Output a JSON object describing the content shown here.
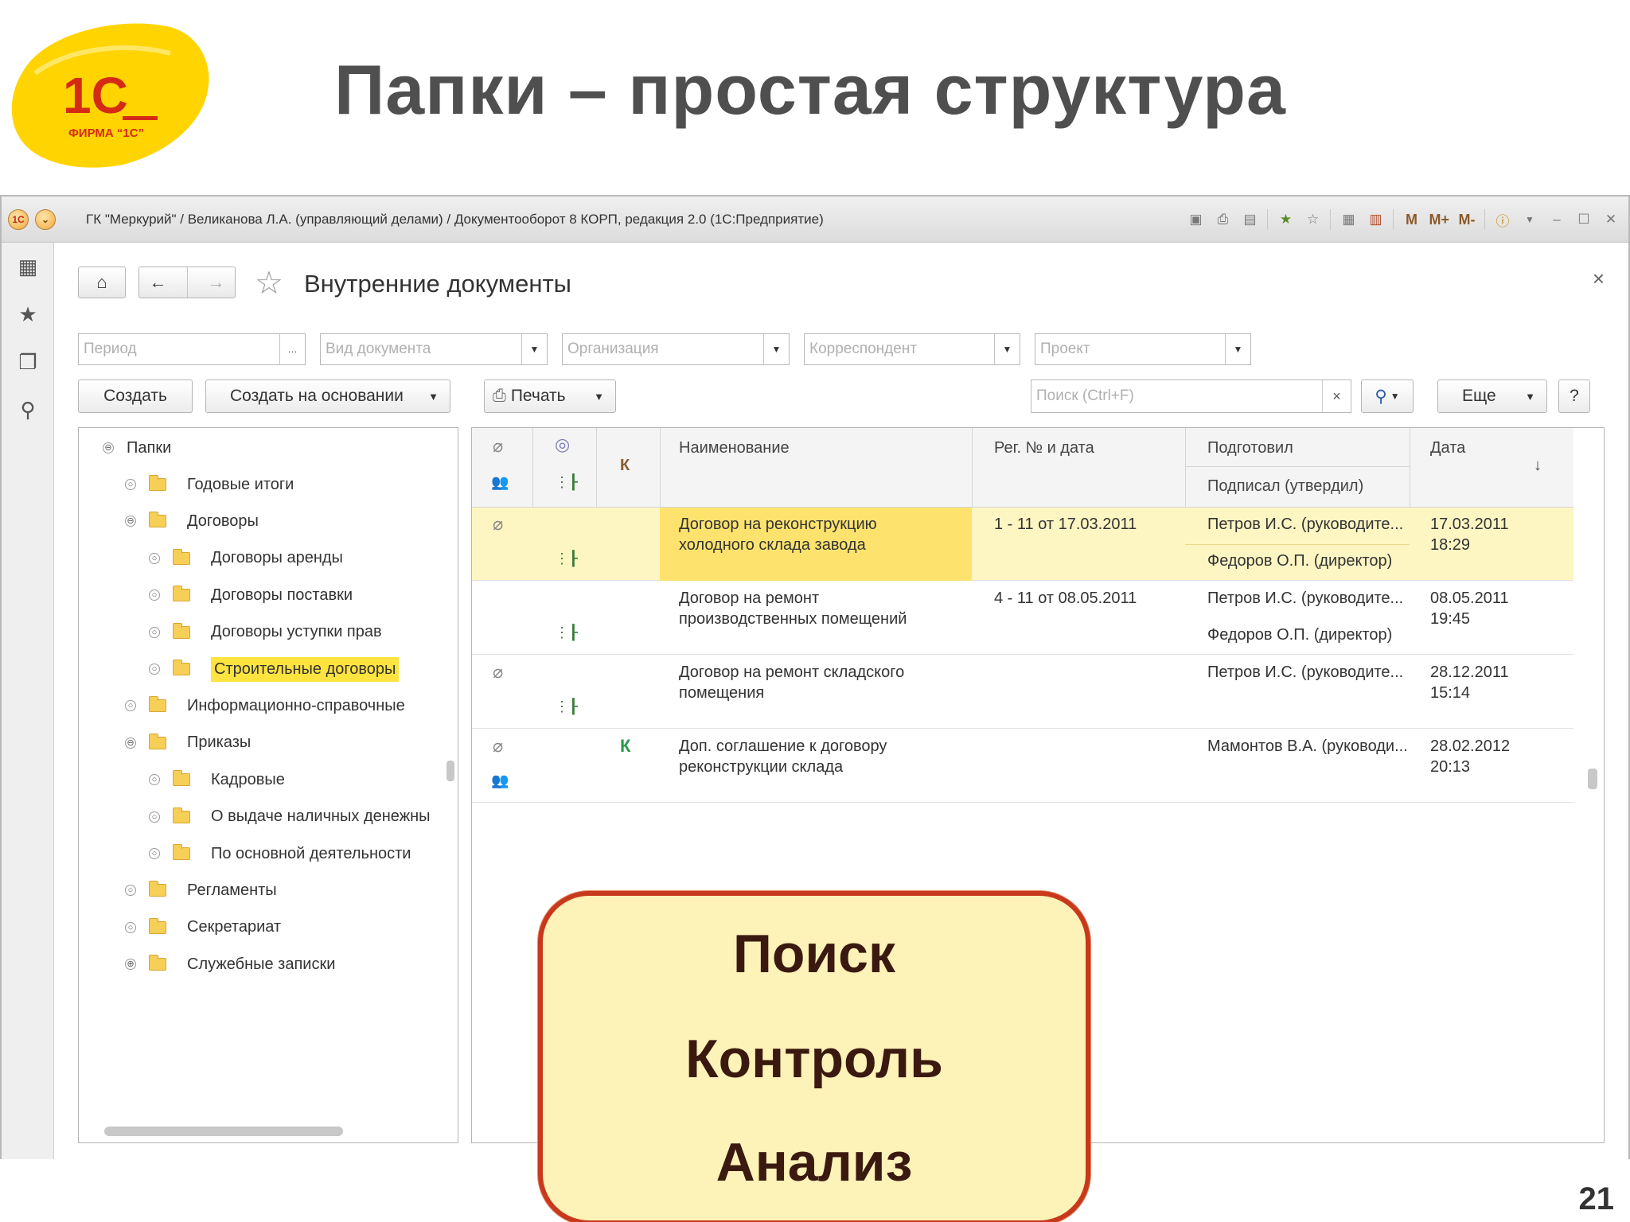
{
  "slide": {
    "title": "Папки – простая структура",
    "number": "21",
    "logo_text": "1С",
    "logo_caption": "ФИРМА “1С”"
  },
  "window": {
    "title": "ГК \"Меркурий\" / Великанова Л.А. (управляющий делами) / Документооборот 8 КОРП, редакция 2.0  (1С:Предприятие)",
    "toolbar_labels": {
      "m": "M",
      "mplus": "M+",
      "mminus": "M-"
    }
  },
  "form": {
    "title": "Внутренние документы",
    "filters": [
      {
        "placeholder": "Период",
        "has_ellipsis": true
      },
      {
        "placeholder": "Вид документа"
      },
      {
        "placeholder": "Организация"
      },
      {
        "placeholder": "Корреспондент"
      },
      {
        "placeholder": "Проект"
      }
    ],
    "buttons": {
      "create": "Создать",
      "create_based": "Создать на основании",
      "print": "Печать",
      "more": "Еще",
      "help": "?"
    },
    "search_placeholder": "Поиск (Ctrl+F)"
  },
  "tree": {
    "root": "Папки",
    "items": [
      {
        "label": "Годовые итоги",
        "level": 1,
        "toggle": "○"
      },
      {
        "label": "Договоры",
        "level": 1,
        "toggle": "⊖"
      },
      {
        "label": "Договоры аренды",
        "level": 2,
        "toggle": "○"
      },
      {
        "label": "Договоры поставки",
        "level": 2,
        "toggle": "○"
      },
      {
        "label": "Договоры уступки прав",
        "level": 2,
        "toggle": "○"
      },
      {
        "label": "Строительные договоры",
        "level": 2,
        "toggle": "○",
        "selected": true
      },
      {
        "label": "Информационно-справочные",
        "level": 1,
        "toggle": "○"
      },
      {
        "label": "Приказы",
        "level": 1,
        "toggle": "⊖"
      },
      {
        "label": "Кадровые",
        "level": 2,
        "toggle": "○"
      },
      {
        "label": "О выдаче наличных денежны",
        "level": 2,
        "toggle": "○"
      },
      {
        "label": "По основной деятельности",
        "level": 2,
        "toggle": "○"
      },
      {
        "label": "Регламенты",
        "level": 1,
        "toggle": "○"
      },
      {
        "label": "Секретариат",
        "level": 1,
        "toggle": "○"
      },
      {
        "label": "Служебные записки",
        "level": 1,
        "toggle": "⊕"
      }
    ]
  },
  "table": {
    "headers": {
      "k": "К",
      "name": "Наименование",
      "reg": "Рег. № и дата",
      "prepared": "Подготовил",
      "signed": "Подписал (утвердил)",
      "date": "Дата",
      "sort": "↓"
    },
    "rows": [
      {
        "attach": true,
        "people": false,
        "k": "",
        "name1": "Договор на реконструкцию",
        "name2": "холодного склада завода",
        "reg": "1 - 11 от 17.03.2011",
        "prepared": "Петров И.С. (руководите...",
        "signed": "Федоров О.П. (директор)",
        "date1": "17.03.2011",
        "date2": "18:29"
      },
      {
        "attach": false,
        "people": false,
        "k": "",
        "name1": "Договор на ремонт",
        "name2": "производственных помещений",
        "reg": "4 - 11 от 08.05.2011",
        "prepared": "Петров И.С. (руководите...",
        "signed": "Федоров О.П. (директор)",
        "date1": "08.05.2011",
        "date2": "19:45"
      },
      {
        "attach": true,
        "people": false,
        "k": "",
        "name1": "Договор на ремонт складского",
        "name2": "помещения",
        "reg": "",
        "prepared": "Петров И.С. (руководите...",
        "signed": "",
        "date1": "28.12.2011",
        "date2": "15:14"
      },
      {
        "attach": true,
        "people": true,
        "k": "К",
        "name1": "Доп. соглашение к договору",
        "name2": "реконструкции склада",
        "reg": "",
        "prepared": "Мамонтов В.А. (руководи...",
        "signed": "",
        "date1": "28.02.2012",
        "date2": "20:13"
      }
    ]
  },
  "callout": {
    "items": [
      "Поиск",
      "Контроль",
      "Анализ"
    ]
  },
  "colors": {
    "selection_yellow": "#ffe33f",
    "row_selected": "#fdf5c2",
    "callout_border": "#c8391c",
    "callout_fill": "#fdf2b8",
    "logo_yellow": "#ffd400",
    "logo_red": "#d42a16"
  }
}
